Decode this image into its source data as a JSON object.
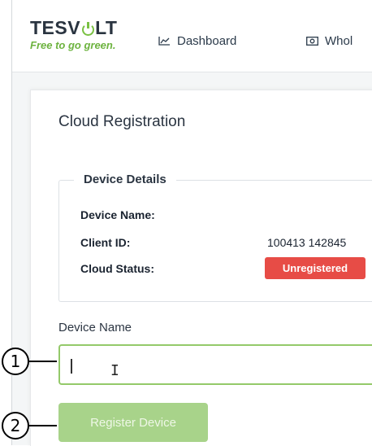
{
  "brand": {
    "name_pre": "TESV",
    "name_post": "LT",
    "tagline": "Free to go green."
  },
  "nav": [
    {
      "label": "Dashboard",
      "icon": "chart-line-icon"
    },
    {
      "label": "Whol",
      "icon": "cash-icon"
    }
  ],
  "card": {
    "title": "Cloud Registration",
    "details": {
      "legend": "Device Details",
      "rows": [
        {
          "label": "Device Name:",
          "value": ""
        },
        {
          "label": "Client ID:",
          "value": "100413 142845"
        },
        {
          "label": "Cloud Status:",
          "value": "Unregistered"
        }
      ]
    },
    "form": {
      "label": "Device Name",
      "value": "",
      "button": "Register Device"
    }
  },
  "callouts": [
    "1",
    "2"
  ],
  "colors": {
    "accent": "#7ac143",
    "badge": "#e74c46",
    "input_border": "#94c96a",
    "button": "#a8d38a"
  }
}
